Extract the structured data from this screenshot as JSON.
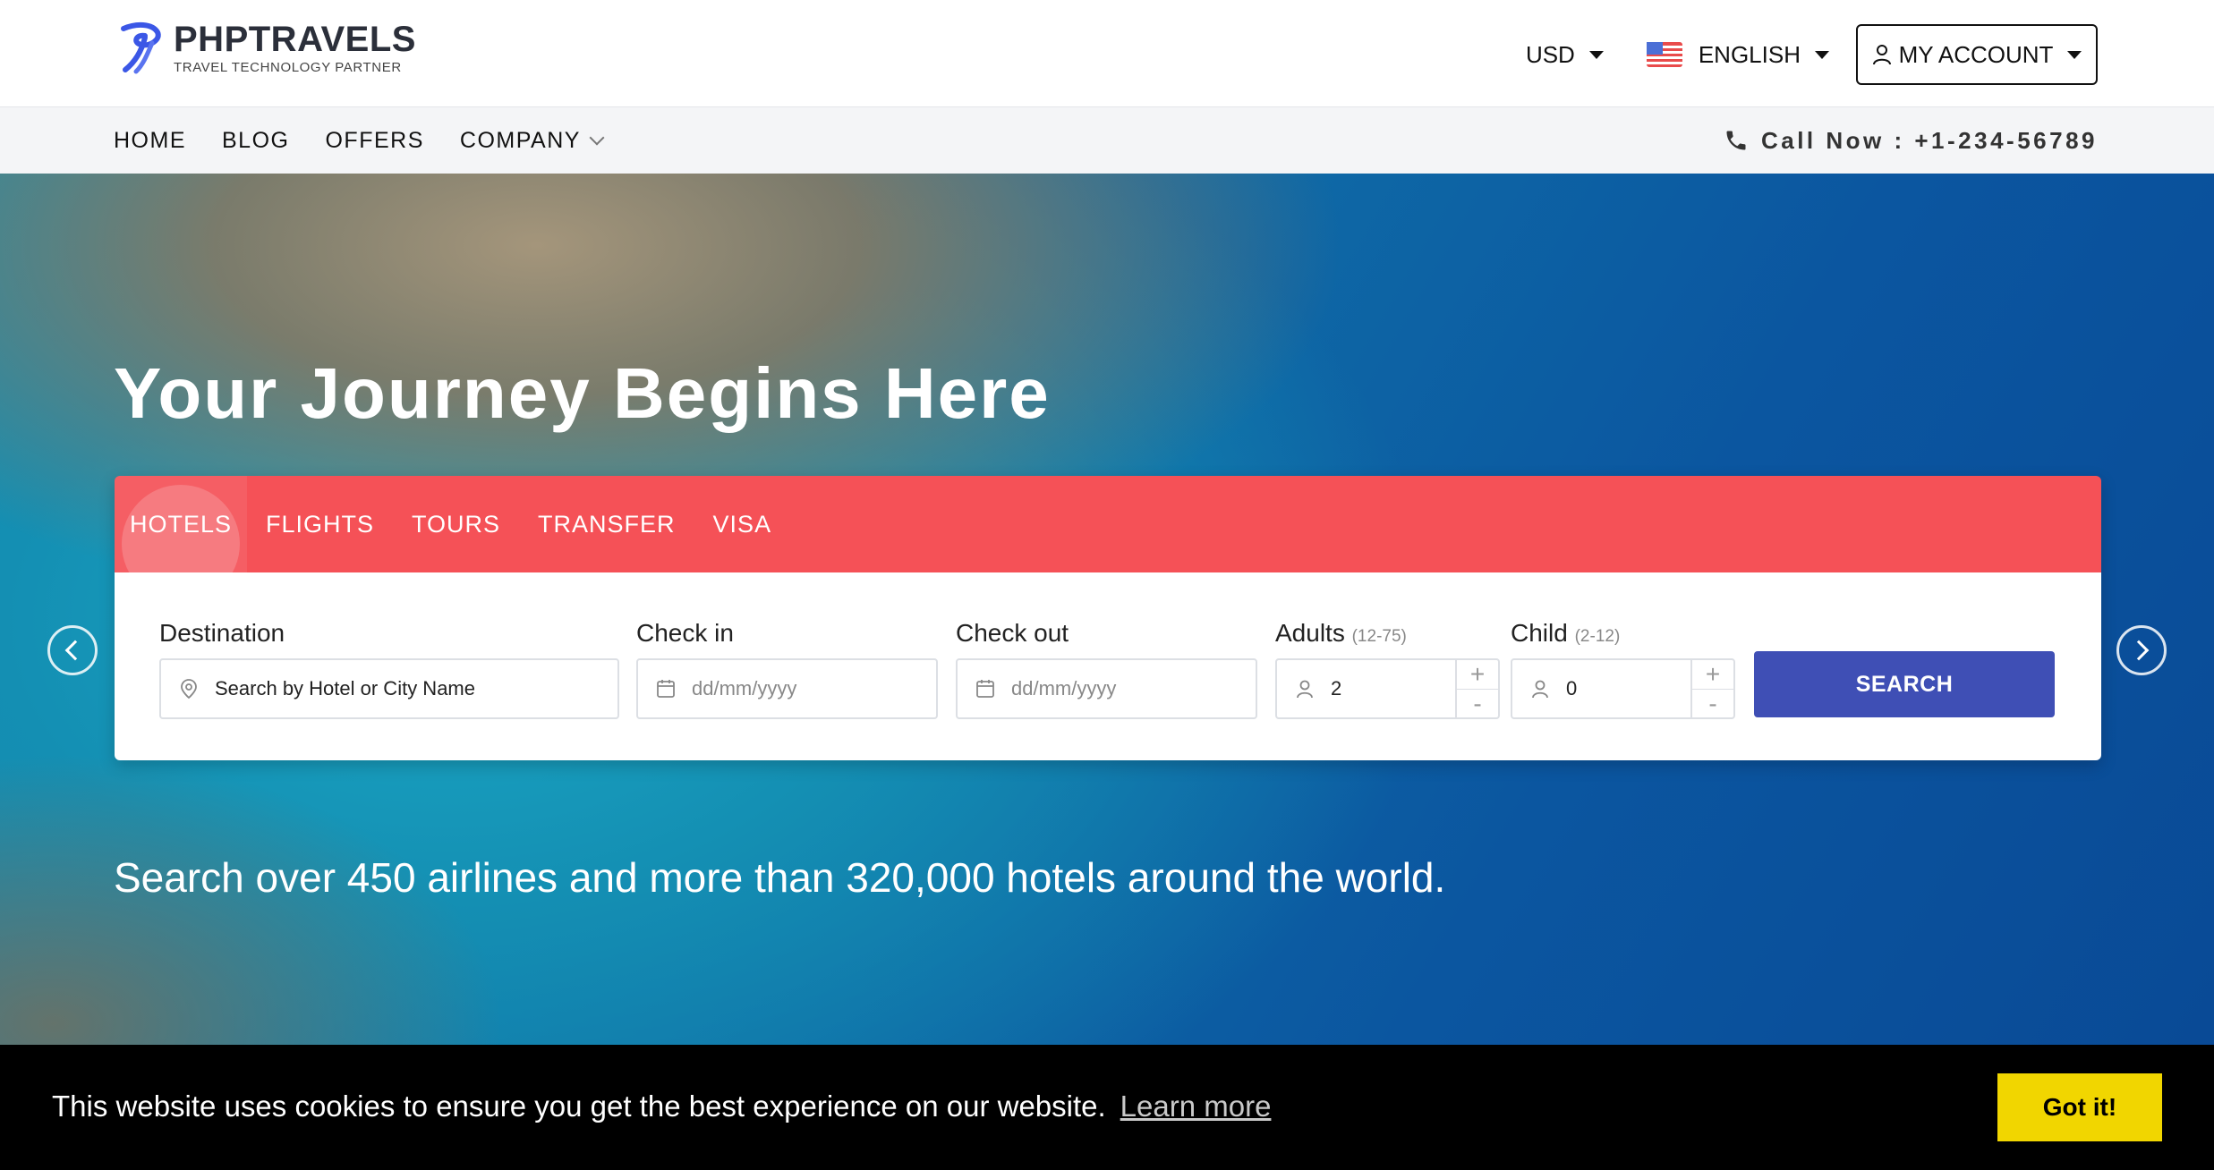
{
  "header": {
    "logo_title": "PHPTRAVELS",
    "logo_subtitle": "TRAVEL TECHNOLOGY PARTNER",
    "currency": "USD",
    "language": "ENGLISH",
    "account": "MY ACCOUNT"
  },
  "nav": {
    "items": [
      "HOME",
      "BLOG",
      "OFFERS",
      "COMPANY"
    ],
    "call": "Call Now : +1-234-56789"
  },
  "hero": {
    "title": "Your Journey Begins Here",
    "subtitle": "Search over 450 airlines and more than 320,000 hotels around the world."
  },
  "search": {
    "tabs": [
      "HOTELS",
      "FLIGHTS",
      "TOURS",
      "TRANSFER",
      "VISA"
    ],
    "active_tab": "HOTELS",
    "destination_label": "Destination",
    "destination_placeholder": "Search by Hotel or City Name",
    "checkin_label": "Check in",
    "checkin_placeholder": "dd/mm/yyyy",
    "checkout_label": "Check out",
    "checkout_placeholder": "dd/mm/yyyy",
    "adults_label": "Adults",
    "adults_range": "(12-75)",
    "adults_value": "2",
    "child_label": "Child",
    "child_range": "(2-12)",
    "child_value": "0",
    "plus": "+",
    "minus": "-",
    "button": "SEARCH"
  },
  "cookie": {
    "message": "This website uses cookies to ensure you get the best experience on our website.",
    "link": "Learn more",
    "button": "Got it!"
  },
  "colors": {
    "tab_bar": "#f55157",
    "search_button": "#3f4fb5",
    "cookie_button": "#f1d600",
    "cookie_bar": "#000000"
  },
  "icons": [
    "logo-icon",
    "flag-us-icon",
    "user-icon",
    "phone-icon",
    "location-pin-icon",
    "calendar-icon",
    "person-icon",
    "chevron-left-icon",
    "chevron-right-icon"
  ]
}
